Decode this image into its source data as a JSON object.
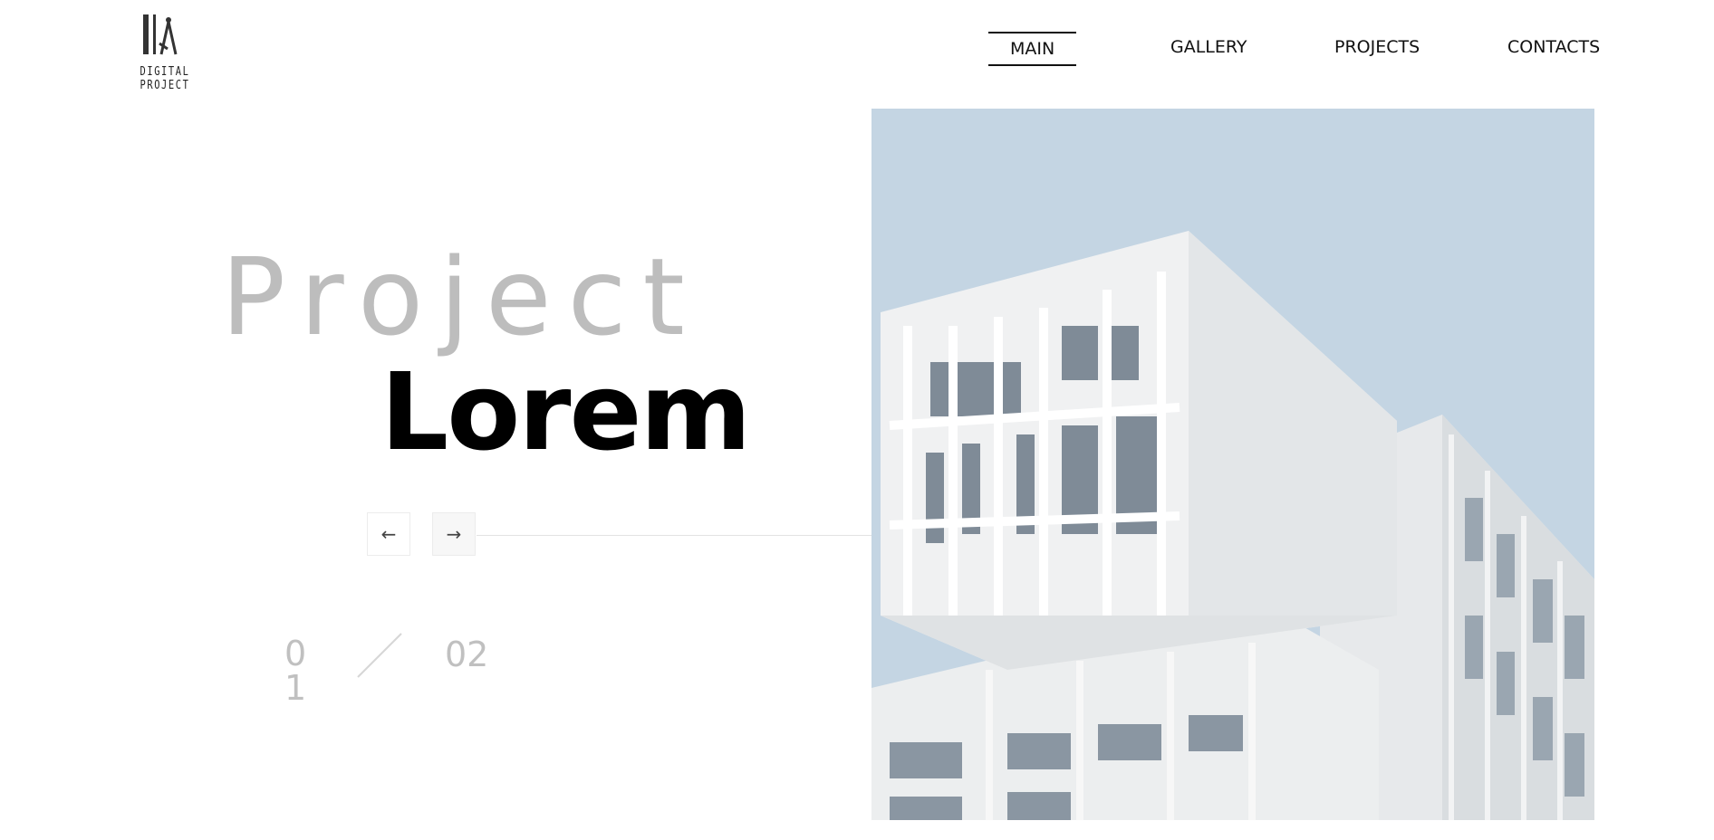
{
  "logo": {
    "text": "DIGITAL PROJECT"
  },
  "nav": {
    "items": [
      "MAIN",
      "GALLERY",
      "PROJECTS",
      "CONTACTS"
    ],
    "active": "MAIN"
  },
  "hero": {
    "title_light": "Project",
    "title_bold": "Lorem",
    "prev_label": "←",
    "next_label": "→",
    "slide_current": "01",
    "slide_total": "02"
  },
  "colors": {
    "sky": "#c4d5e3",
    "muted_text": "#bdbdbd"
  },
  "icons": {
    "logo": "ruler-compass-icon",
    "prev": "arrow-left-icon",
    "next": "arrow-right-icon"
  }
}
